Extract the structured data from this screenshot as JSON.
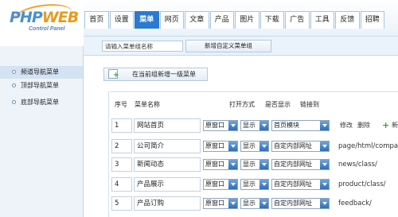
{
  "logo": {
    "brand_main": "PHP",
    "brand_accent": "WEB",
    "subtitle": "Control Panel"
  },
  "nav": {
    "tabs": [
      "首页",
      "设置",
      "菜单",
      "网页",
      "文章",
      "产品",
      "图片",
      "下载",
      "广告",
      "工具",
      "反馈",
      "招聘"
    ],
    "active_index": 2
  },
  "toolbar": {
    "group_name_value": "请输入菜单组名称",
    "add_custom_button": "新增自定义菜单组"
  },
  "sidebar": {
    "items": [
      "频道导航菜单",
      "顶部导航菜单",
      "底部导航菜单"
    ],
    "active_index": 0
  },
  "main": {
    "add_top_button": "在当前组新增一级菜单"
  },
  "table": {
    "headers": {
      "num": "序号",
      "name": "菜单名称",
      "open": "打开方式",
      "show": "是否显示",
      "link": "链接到"
    },
    "rows": [
      {
        "num": "1",
        "name": "网站首页",
        "open": "原窗口",
        "show": "显示",
        "target": "首页模块",
        "link": "",
        "actions": [
          "修改",
          "删除"
        ],
        "extra": "新"
      },
      {
        "num": "2",
        "name": "公司简介",
        "open": "原窗口",
        "show": "显示",
        "target": "自定内部网址",
        "link": "page/html/compar"
      },
      {
        "num": "3",
        "name": "新闻动态",
        "open": "原窗口",
        "show": "显示",
        "target": "自定内部网址",
        "link": "news/class/"
      },
      {
        "num": "4",
        "name": "产品展示",
        "open": "原窗口",
        "show": "显示",
        "target": "自定内部网址",
        "link": "product/class/"
      },
      {
        "num": "5",
        "name": "产品订购",
        "open": "原窗口",
        "show": "显示",
        "target": "自定内部网址",
        "link": "feedback/"
      }
    ]
  },
  "colors": {
    "accent": "#2a7ad0",
    "brand_blue": "#4a8fd0",
    "brand_orange": "#e89b1c",
    "add_green": "#3aa03a"
  }
}
